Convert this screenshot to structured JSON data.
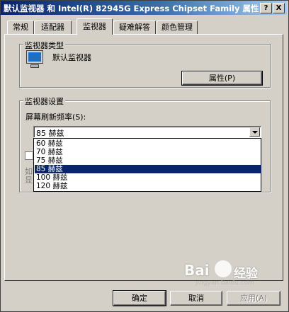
{
  "window": {
    "title": "默认监视器 和 Intel(R) 82945G Express Chipset Family 属性",
    "help_btn": "?",
    "close_btn": "X"
  },
  "tabs": [
    {
      "label": "常规"
    },
    {
      "label": "适配器"
    },
    {
      "label": "监视器"
    },
    {
      "label": "疑难解答"
    },
    {
      "label": "颜色管理"
    }
  ],
  "monitor_type": {
    "group_label": "监视器类型",
    "monitor_name": "默认监视器",
    "properties_button": "属性(P)"
  },
  "monitor_settings": {
    "group_label": "监视器设置",
    "refresh_label": "屏幕刷新频率(S):",
    "refresh_selected": "85 赫兹",
    "refresh_options": [
      "60 赫兹",
      "70 赫兹",
      "75 赫兹",
      "85 赫兹",
      "100 赫兹",
      "120 赫兹"
    ],
    "refresh_highlighted_index": 3,
    "obscured_line1": "如",
    "obscured_line2": "显"
  },
  "buttons": {
    "ok": "确定",
    "cancel": "取消",
    "apply": "应用(A)"
  },
  "watermark": {
    "brand": "Bai",
    "brand_suffix": "经验",
    "url": "jingyan.baidu.com"
  }
}
